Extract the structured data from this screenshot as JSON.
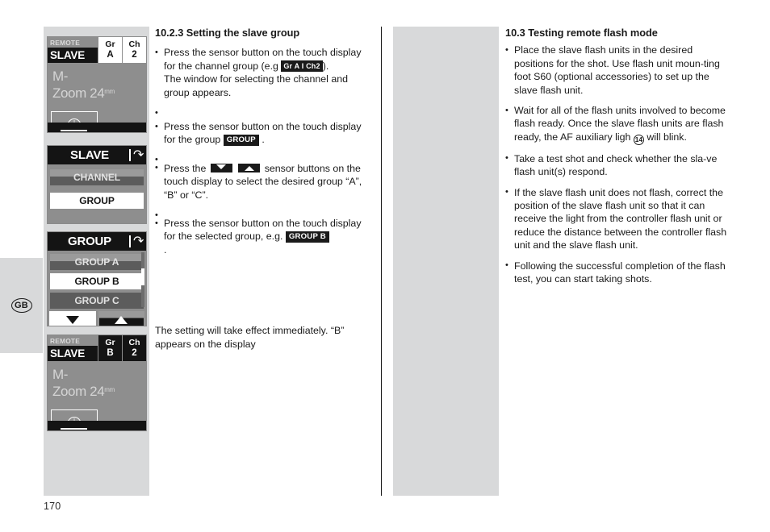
{
  "page": {
    "number": "170",
    "language_tab": "GB"
  },
  "displays": {
    "status_a": {
      "mode_line1": "REMOTE",
      "mode_line2": "SLAVE",
      "gr_label": "Gr",
      "gr_value": "A",
      "ch_label": "Ch",
      "ch_value": "2",
      "body_line1": "M-",
      "body_line2": "Zoom 24",
      "body_unit": "mm",
      "softkey_icon": "info-icon"
    },
    "slave_menu": {
      "title": "SLAVE",
      "back_icon": "back-arrow-icon",
      "rows": [
        {
          "label": "CHANNEL",
          "state": "dim"
        },
        {
          "label": "GROUP",
          "state": "selected"
        }
      ]
    },
    "group_menu": {
      "title": "GROUP",
      "back_icon": "back-arrow-icon",
      "rows": [
        {
          "label": "GROUP A",
          "state": "dim"
        },
        {
          "label": "GROUP B",
          "state": "selected"
        },
        {
          "label": "GROUP C",
          "state": "dim"
        }
      ],
      "down_key_icon": "triangle-down-icon",
      "up_key_icon": "triangle-up-icon"
    },
    "status_b": {
      "mode_line1": "REMOTE",
      "mode_line2": "SLAVE",
      "gr_label": "Gr",
      "gr_value": "B",
      "ch_label": "Ch",
      "ch_value": "2",
      "body_line1": "M-",
      "body_line2": "Zoom 24",
      "body_unit": "mm",
      "softkey_icon": "info-icon"
    }
  },
  "middle_column": {
    "heading": "10.2.3 Setting the slave group",
    "b1_part1": "Press the sensor button on the touch display for the channel group (e.g",
    "b1_chip": "Gr A  I  Ch2",
    "b1_part2": ").",
    "b1_part3": "The window for selecting the channel and group appears.",
    "b2_part1": "Press the sensor button on the touch display for the group",
    "b2_chip": "GROUP",
    "b2_part2": ".",
    "b3_part1": "Press the",
    "b3_icon_down": "triangle-down-icon",
    "b3_icon_up": "triangle-up-icon",
    "b3_part2": "sensor buttons on the touch display to select the desired group “A”, “B” or “C”.",
    "b4_part1": "Press the sensor button on the touch display for the selected group, e.g.",
    "b4_chip": "GROUP B",
    "b4_part2": ".",
    "closing": "The setting will take effect immediately. “B” appears on the display"
  },
  "right_column": {
    "heading": "10.3 Testing remote flash mode",
    "bullets": [
      "Place the slave flash units in the desired positions for the shot. Use flash unit moun-ting foot S60 (optional accessories) to set up the slave flash unit.",
      "Take a test shot and check whether the sla-ve flash unit(s) respond.",
      "If the slave flash unit does not flash, correct the position of the slave flash unit so that it can receive the light from the controller flash unit or reduce the distance between the controller flash unit and the slave flash unit.",
      "Following the successful completion of the flash test, you can start taking shots."
    ],
    "b2_part1": "Wait for all of the flash units involved to become flash ready. Once the slave flash units are flash ready, the AF auxiliary ligh",
    "b2_ref": "14",
    "b2_part2": "will blink."
  }
}
